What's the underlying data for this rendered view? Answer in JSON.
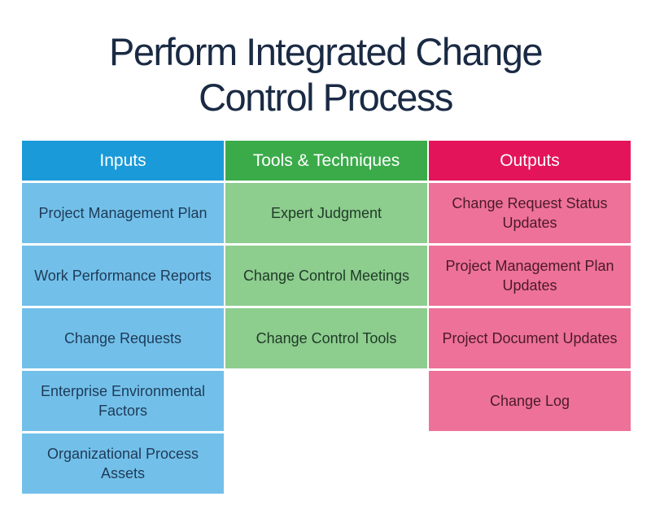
{
  "title": {
    "line1": "Perform Integrated Change",
    "line2": "Control Process"
  },
  "colors": {
    "inputs_header": "#1b9ad9",
    "inputs_cell": "#72c0ea",
    "tools_header": "#3bab4a",
    "tools_cell": "#8dcd8e",
    "outputs_header": "#e4145a",
    "outputs_cell": "#ee7199"
  },
  "columns": [
    {
      "header": "Inputs",
      "items": [
        "Project Management Plan",
        "Work Performance Reports",
        "Change Requests",
        "Enterprise Environmental Factors",
        "Organizational Process Assets"
      ]
    },
    {
      "header": "Tools & Techniques",
      "items": [
        "Expert Judgment",
        "Change Control Meetings",
        "Change Control Tools"
      ]
    },
    {
      "header": "Outputs",
      "items": [
        "Change Request Status Updates",
        "Project Management Plan Updates",
        "Project Document Updates",
        "Change Log"
      ]
    }
  ]
}
